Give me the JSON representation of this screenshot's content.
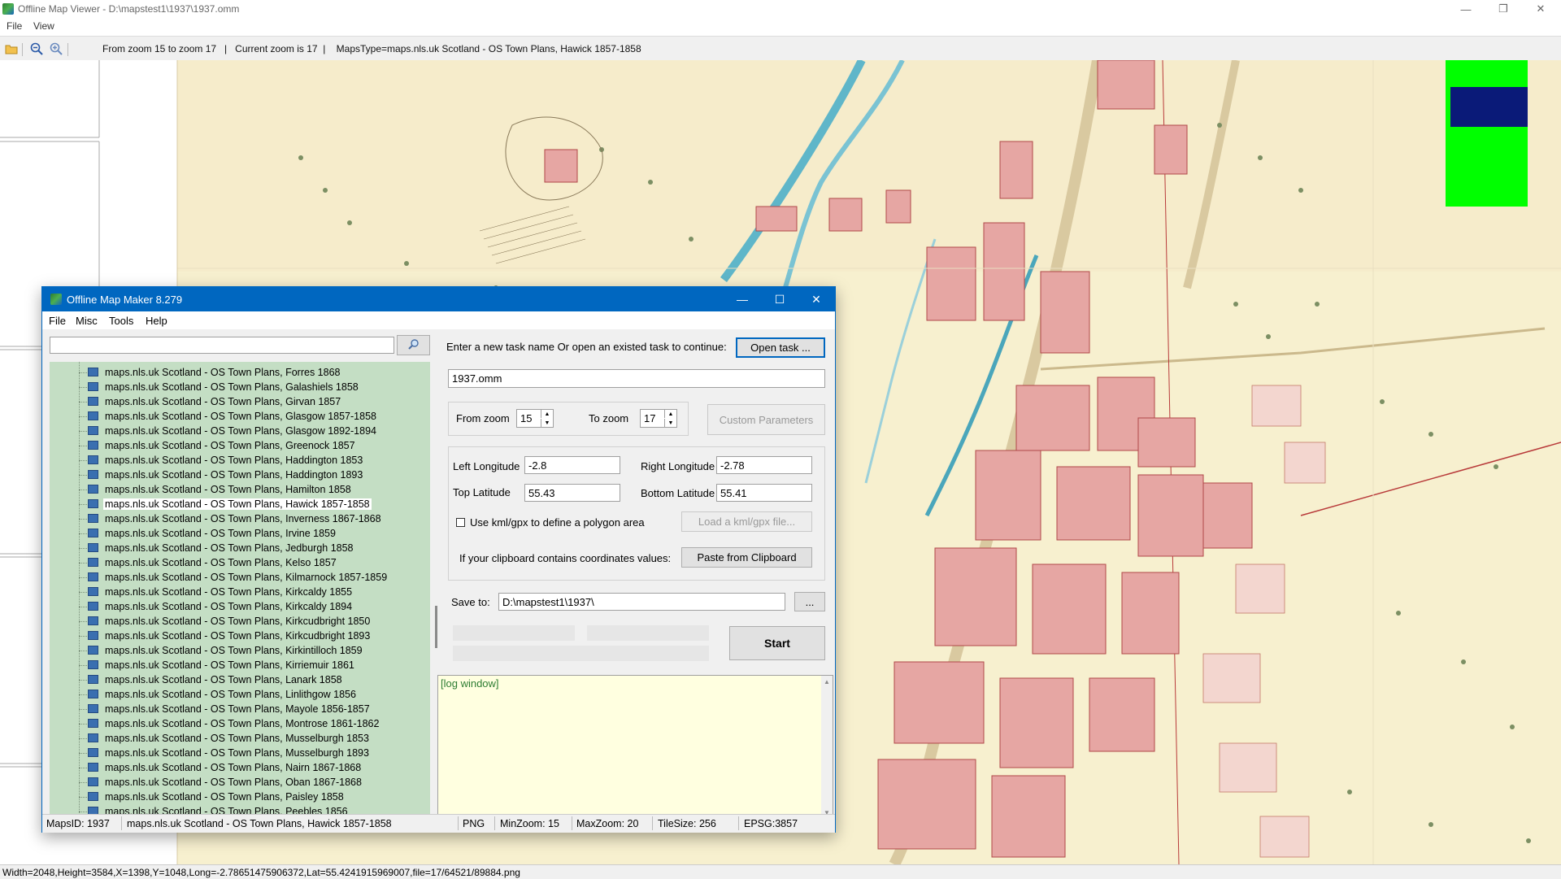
{
  "app": {
    "title": "Offline Map Viewer - D:\\mapstest1\\1937\\1937.omm",
    "menu": [
      "File",
      "View"
    ],
    "toolbar_info": "From zoom 15 to zoom 17   |   Current zoom is 17  |    MapsType=maps.nls.uk Scotland - OS Town Plans, Hawick 1857-1858",
    "status": "Width=2048,Height=3584,X=1398,Y=1048,Long=-2.78651475906372,Lat=55.4241915969007,file=17/64521/89884.png",
    "icons": {
      "open": "folder-open-icon",
      "zoom_out": "zoom-out-icon",
      "zoom_in": "zoom-in-icon"
    },
    "colors": {
      "minimap_bg": "#00ff00",
      "minimap_view": "#0a1a78",
      "map_paper": "#f7f0cf"
    }
  },
  "dialog": {
    "title": "Offline Map Maker 8.279",
    "menu": [
      "File",
      "Misc",
      "Tools",
      "Help"
    ],
    "search_value": "",
    "task_prompt": "Enter a new task name Or open an existed task to continue:",
    "open_task_label": "Open task ...",
    "task_name": "1937.omm",
    "from_zoom_label": "From zoom",
    "from_zoom": "15",
    "to_zoom_label": "To zoom",
    "to_zoom": "17",
    "custom_params_label": "Custom Parameters",
    "left_lon_label": "Left Longitude",
    "left_lon": "-2.8",
    "right_lon_label": "Right Longitude",
    "right_lon": "-2.78",
    "top_lat_label": "Top Latitude",
    "top_lat": "55.43",
    "bottom_lat_label": "Bottom Latitude",
    "bottom_lat": "55.41",
    "kml_label": "Use kml/gpx to define a polygon area",
    "kml_checked": false,
    "load_kml_label": "Load a kml/gpx file...",
    "clipboard_text": "If your clipboard contains coordinates values:",
    "paste_label": "Paste from Clipboard",
    "save_to_label": "Save to:",
    "save_to": "D:\\mapstest1\\1937\\",
    "browse_label": "...",
    "start_label": "Start",
    "log_text": "[log window]",
    "tree_items": [
      "maps.nls.uk Scotland - OS Town Plans, Forres 1868",
      "maps.nls.uk Scotland - OS Town Plans, Galashiels 1858",
      "maps.nls.uk Scotland - OS Town Plans, Girvan 1857",
      "maps.nls.uk Scotland - OS Town Plans, Glasgow 1857-1858",
      "maps.nls.uk Scotland - OS Town Plans, Glasgow 1892-1894",
      "maps.nls.uk Scotland - OS Town Plans, Greenock 1857",
      "maps.nls.uk Scotland - OS Town Plans, Haddington 1853",
      "maps.nls.uk Scotland - OS Town Plans, Haddington 1893",
      "maps.nls.uk Scotland - OS Town Plans, Hamilton 1858",
      "maps.nls.uk Scotland - OS Town Plans, Hawick 1857-1858",
      "maps.nls.uk Scotland - OS Town Plans, Inverness 1867-1868",
      "maps.nls.uk Scotland - OS Town Plans, Irvine 1859",
      "maps.nls.uk Scotland - OS Town Plans, Jedburgh 1858",
      "maps.nls.uk Scotland - OS Town Plans, Kelso 1857",
      "maps.nls.uk Scotland - OS Town Plans, Kilmarnock 1857-1859",
      "maps.nls.uk Scotland - OS Town Plans, Kirkcaldy 1855",
      "maps.nls.uk Scotland - OS Town Plans, Kirkcaldy 1894",
      "maps.nls.uk Scotland - OS Town Plans, Kirkcudbright 1850",
      "maps.nls.uk Scotland - OS Town Plans, Kirkcudbright 1893",
      "maps.nls.uk Scotland - OS Town Plans, Kirkintilloch 1859",
      "maps.nls.uk Scotland - OS Town Plans, Kirriemuir 1861",
      "maps.nls.uk Scotland - OS Town Plans, Lanark 1858",
      "maps.nls.uk Scotland - OS Town Plans, Linlithgow 1856",
      "maps.nls.uk Scotland - OS Town Plans, Mayole 1856-1857",
      "maps.nls.uk Scotland - OS Town Plans, Montrose 1861-1862",
      "maps.nls.uk Scotland - OS Town Plans, Musselburgh 1853",
      "maps.nls.uk Scotland - OS Town Plans, Musselburgh 1893",
      "maps.nls.uk Scotland - OS Town Plans, Nairn 1867-1868",
      "maps.nls.uk Scotland - OS Town Plans, Oban 1867-1868",
      "maps.nls.uk Scotland - OS Town Plans, Paisley 1858",
      "maps.nls.uk Scotland - OS Town Plans, Peebles 1856"
    ],
    "selected_item": "maps.nls.uk Scotland - OS Town Plans, Hawick 1857-1858",
    "status": {
      "maps_id": "MapsID: 1937",
      "map_name": "maps.nls.uk Scotland - OS Town Plans, Hawick 1857-1858",
      "format": "PNG",
      "min_zoom": "MinZoom: 15",
      "max_zoom": "MaxZoom: 20",
      "tile_size": "TileSize: 256",
      "epsg": "EPSG:3857"
    }
  }
}
